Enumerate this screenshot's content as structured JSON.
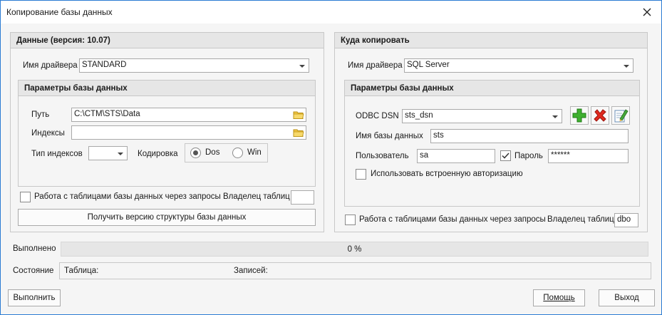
{
  "window": {
    "title": "Копирование базы данных"
  },
  "source": {
    "header": "Данные (версия: 10.07)",
    "driver_label": "Имя драйвера",
    "driver_value": "STANDARD",
    "params_header": "Параметры базы данных",
    "path_label": "Путь",
    "path_value": "C:\\CTM\\STS\\Data",
    "indexes_label": "Индексы",
    "indexes_value": "",
    "index_type_label": "Тип индексов",
    "index_type_value": "",
    "encoding_label": "Кодировка",
    "encoding_options": [
      "Dos",
      "Win"
    ],
    "encoding_selected": "Dos",
    "query_mode_label": "Работа с таблицами базы данных через запросы",
    "query_mode_checked": false,
    "owner_label": "Владелец таблиц",
    "owner_value": "",
    "get_structure_button": "Получить версию структуры базы данных"
  },
  "target": {
    "header": "Куда копировать",
    "driver_label": "Имя драйвера",
    "driver_value": "SQL Server",
    "params_header": "Параметры базы данных",
    "dsn_label": "ODBC DSN",
    "dsn_value": "sts_dsn",
    "dbname_label": "Имя базы данных",
    "dbname_value": "sts",
    "user_label": "Пользователь",
    "user_value": "sa",
    "password_label": "Пароль",
    "password_checked": true,
    "password_value": "******",
    "builtin_auth_label": "Использовать встроенную авторизацию",
    "builtin_auth_checked": false,
    "query_mode_label": "Работа с таблицами базы данных через запросы",
    "query_mode_checked": false,
    "owner_label": "Владелец таблиц",
    "owner_value": "dbo"
  },
  "progress": {
    "label": "Выполнено",
    "percent": 0,
    "text": "0 %"
  },
  "status": {
    "label": "Состояние",
    "table_label": "Таблица:",
    "records_label": "Записей:"
  },
  "buttons": {
    "run": "Выполнить",
    "help": "Помощь",
    "exit": "Выход"
  },
  "colors": {
    "accent": "#2b7cd3",
    "progress_fill": "#3c8fd8"
  },
  "icons": [
    "close-icon",
    "folder-icon",
    "add-icon",
    "delete-icon",
    "edit-icon"
  ]
}
